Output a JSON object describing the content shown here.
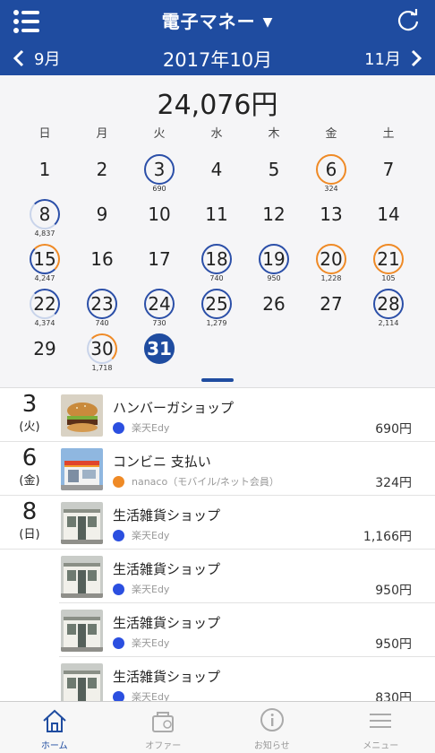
{
  "header": {
    "title": "電子マネー",
    "caret": "▼",
    "prev_month": "9月",
    "current_month": "2017年10月",
    "next_month": "11月"
  },
  "calendar": {
    "total": "24,076円",
    "weekdays": [
      "日",
      "月",
      "火",
      "水",
      "木",
      "金",
      "土"
    ],
    "days": [
      {
        "d": "",
        "amt": ""
      },
      {
        "d": "1",
        "amt": ""
      },
      {
        "d": "2",
        "amt": ""
      },
      {
        "d": "3",
        "amt": "690",
        "ring": "blue"
      },
      {
        "d": "4",
        "amt": ""
      },
      {
        "d": "5",
        "amt": ""
      },
      {
        "d": "6",
        "amt": "324",
        "ring": "orange"
      },
      {
        "d": "7",
        "amt": ""
      },
      {
        "d": "8",
        "amt": "4,837",
        "ring": "partial"
      },
      {
        "d": "9",
        "amt": ""
      },
      {
        "d": "10",
        "amt": ""
      },
      {
        "d": "11",
        "amt": ""
      },
      {
        "d": "12",
        "amt": ""
      },
      {
        "d": "13",
        "amt": ""
      },
      {
        "d": "14",
        "amt": ""
      },
      {
        "d": "15",
        "amt": "4,247",
        "ring": "mix"
      },
      {
        "d": "16",
        "amt": ""
      },
      {
        "d": "17",
        "amt": ""
      },
      {
        "d": "18",
        "amt": "740",
        "ring": "blue"
      },
      {
        "d": "19",
        "amt": "950",
        "ring": "blue"
      },
      {
        "d": "20",
        "amt": "1,228",
        "ring": "orange"
      },
      {
        "d": "21",
        "amt": "105",
        "ring": "orange"
      },
      {
        "d": "22",
        "amt": "4,374",
        "ring": "partial"
      },
      {
        "d": "23",
        "amt": "740",
        "ring": "blue"
      },
      {
        "d": "24",
        "amt": "730",
        "ring": "blue"
      },
      {
        "d": "25",
        "amt": "1,279",
        "ring": "blue"
      },
      {
        "d": "26",
        "amt": ""
      },
      {
        "d": "27",
        "amt": ""
      },
      {
        "d": "28",
        "amt": "2,114",
        "ring": "blue"
      },
      {
        "d": "29",
        "amt": ""
      },
      {
        "d": "30",
        "amt": "1,718",
        "ring": "partial-o"
      },
      {
        "d": "31",
        "amt": "",
        "ring": "filled",
        "selected": true
      }
    ]
  },
  "transactions": [
    {
      "date": "3",
      "weekday": "(火)",
      "shop": "ハンバーガショップ",
      "dot": "blue",
      "method": "楽天Edy",
      "price": "690円",
      "thumb": "burger"
    },
    {
      "date": "6",
      "weekday": "(金)",
      "shop": "コンビニ 支払い",
      "dot": "orange",
      "method": "nanaco（モバイル/ネット会員）",
      "price": "324円",
      "thumb": "store"
    },
    {
      "date": "8",
      "weekday": "(日)",
      "shop": "生活雑貨ショップ",
      "dot": "blue",
      "method": "楽天Edy",
      "price": "1,166円",
      "thumb": "shop"
    },
    {
      "date": "",
      "weekday": "",
      "shop": "生活雑貨ショップ",
      "dot": "blue",
      "method": "楽天Edy",
      "price": "950円",
      "thumb": "shop"
    },
    {
      "date": "",
      "weekday": "",
      "shop": "生活雑貨ショップ",
      "dot": "blue",
      "method": "楽天Edy",
      "price": "950円",
      "thumb": "shop"
    },
    {
      "date": "",
      "weekday": "",
      "shop": "生活雑貨ショップ",
      "dot": "blue",
      "method": "楽天Edy",
      "price": "830円",
      "thumb": "shop"
    }
  ],
  "tabs": [
    {
      "label": "ホーム",
      "icon": "home-icon",
      "active": true
    },
    {
      "label": "オファー",
      "icon": "offer-icon",
      "active": false
    },
    {
      "label": "お知らせ",
      "icon": "info-icon",
      "active": false
    },
    {
      "label": "メニュー",
      "icon": "menu-icon",
      "active": false
    }
  ],
  "colors": {
    "primary": "#1f4ca0",
    "edy": "#2b4fe0",
    "nanaco": "#ef8a26"
  }
}
